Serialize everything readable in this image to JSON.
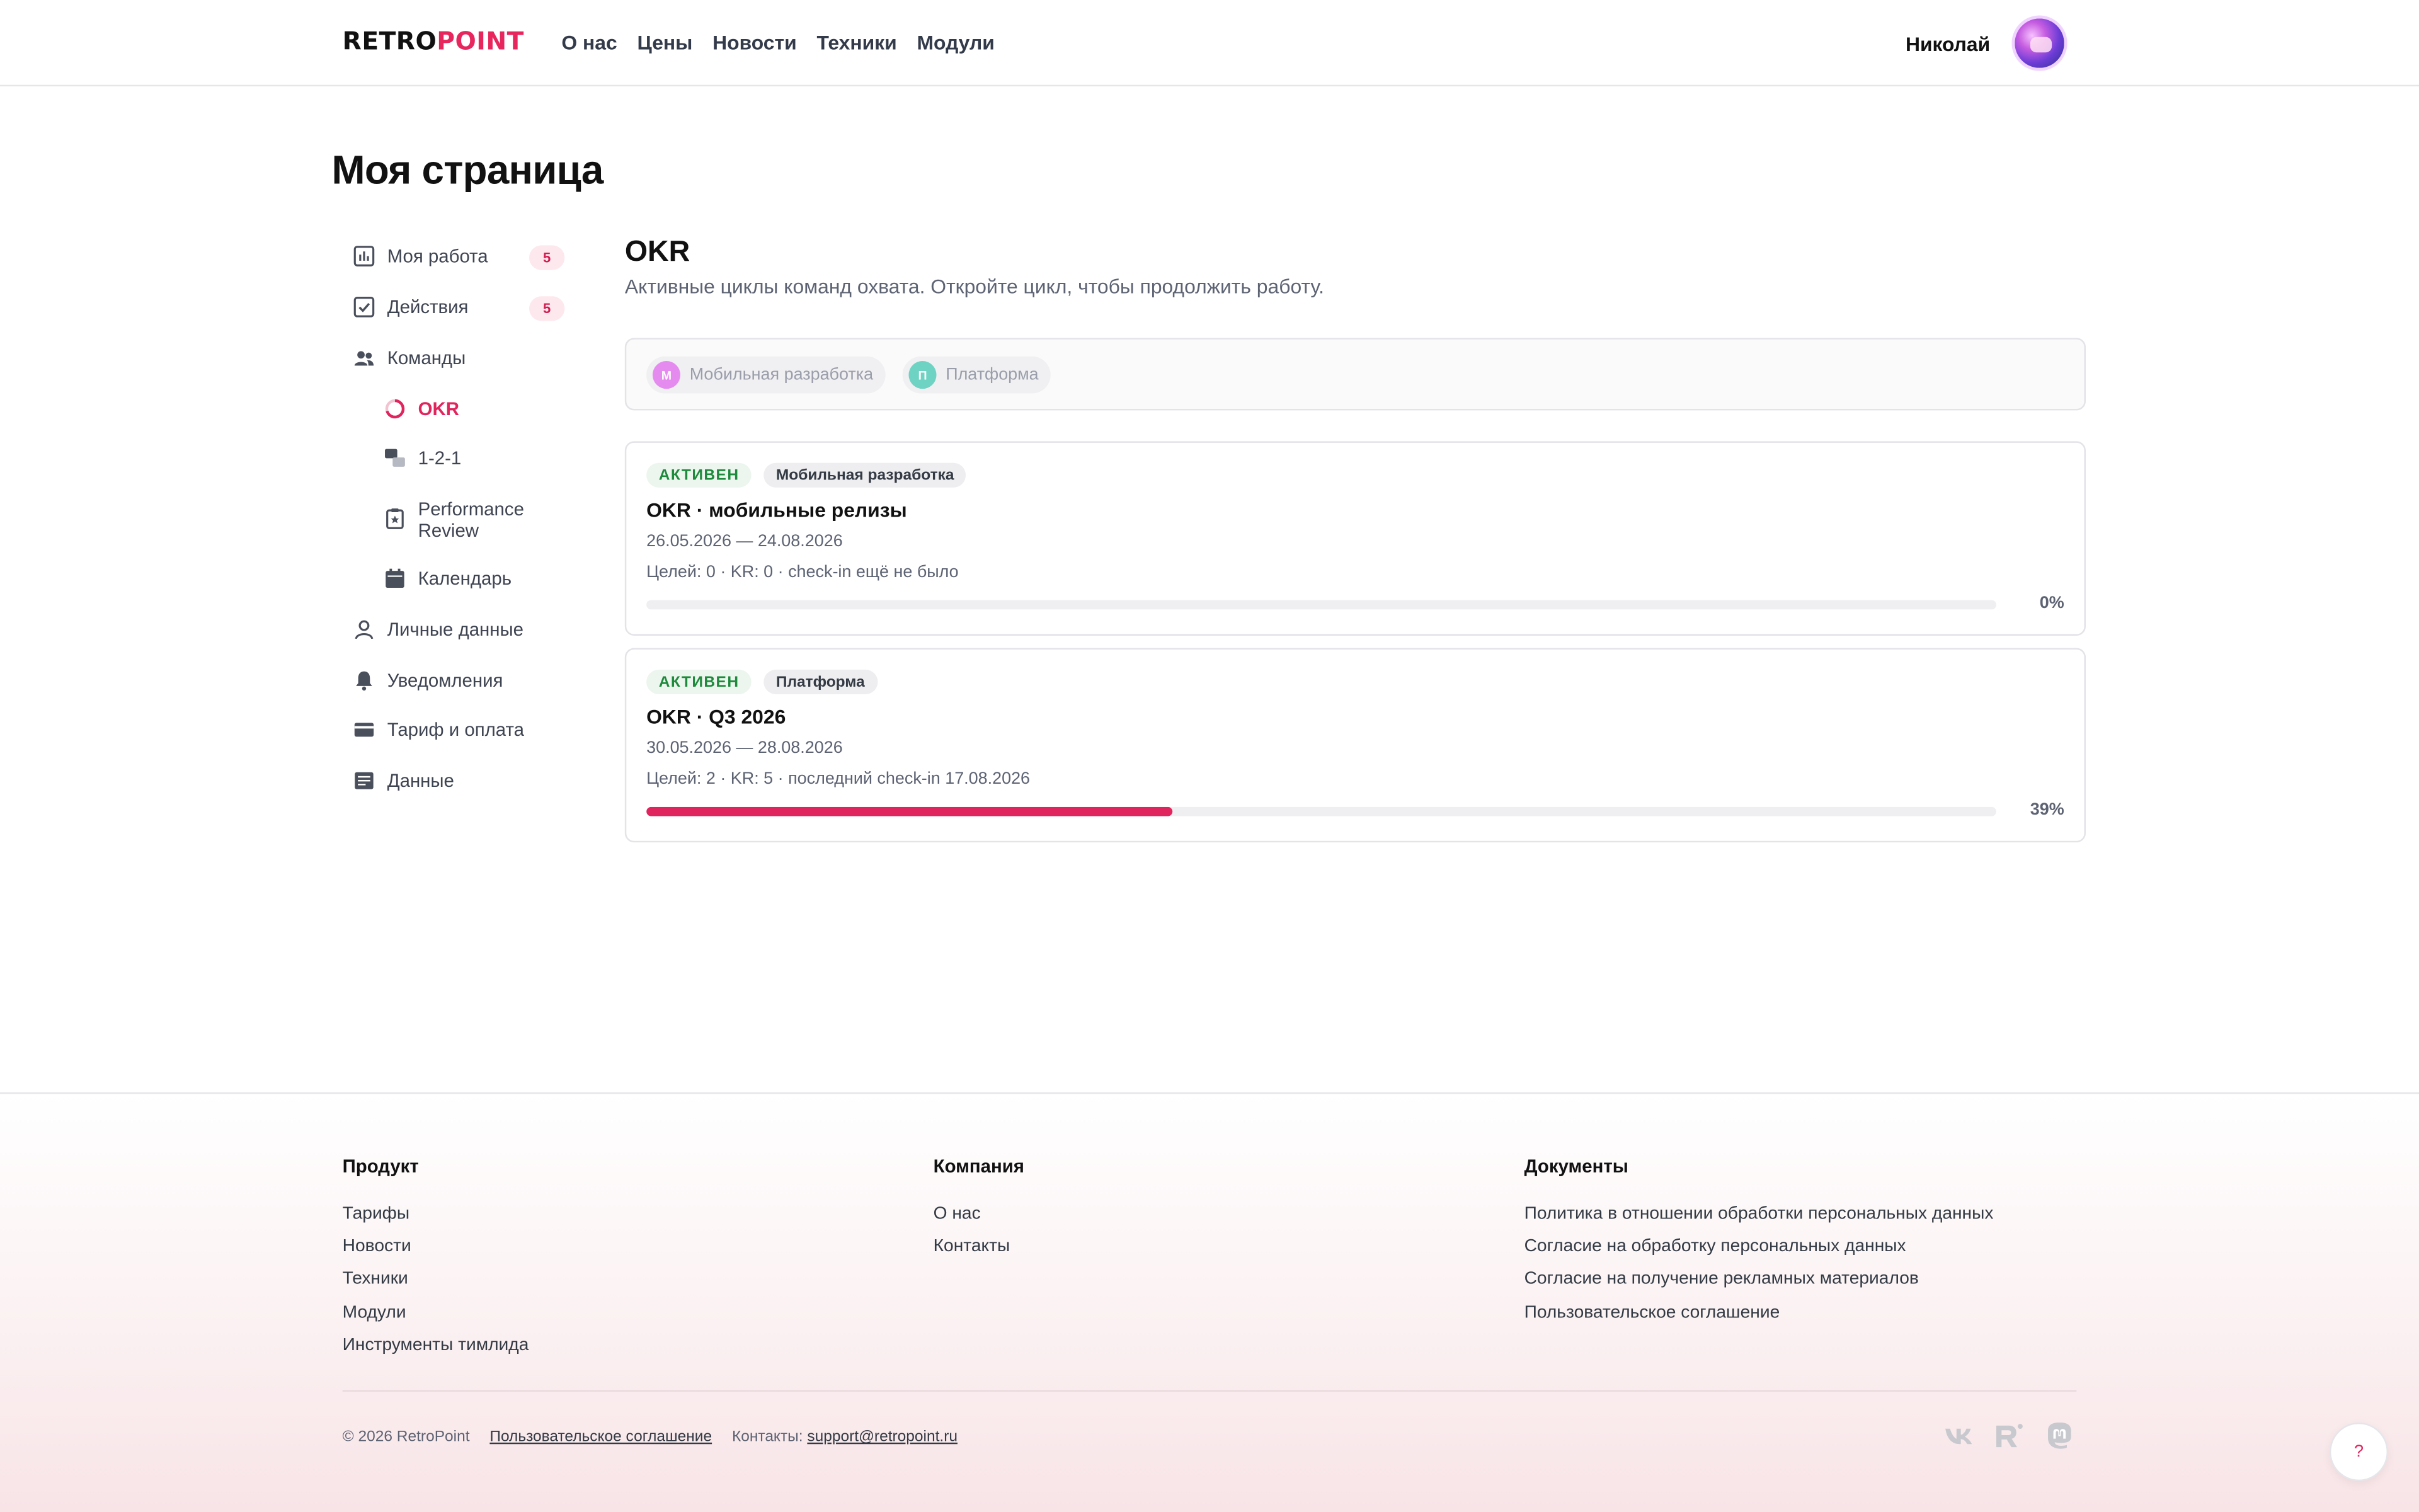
{
  "header": {
    "logo_a": "RETRO",
    "logo_b": "POINT",
    "nav": [
      "О нас",
      "Цены",
      "Новости",
      "Техники",
      "Модули"
    ],
    "user_name": "Николай"
  },
  "page_title": "Моя страница",
  "sidebar": {
    "items": [
      {
        "label": "Моя работа",
        "icon": "chart-icon",
        "badge": "5"
      },
      {
        "label": "Действия",
        "icon": "checkbox-icon",
        "badge": "5"
      },
      {
        "label": "Команды",
        "icon": "team-icon"
      },
      {
        "label": "OKR",
        "icon": "okr-ring-icon",
        "active": true
      },
      {
        "label": "1-2-1",
        "icon": "chat-icon"
      },
      {
        "label": "Performance Review",
        "icon": "clipboard-star-icon"
      },
      {
        "label": "Календарь",
        "icon": "calendar-icon"
      },
      {
        "label": "Личные данные",
        "icon": "person-icon"
      },
      {
        "label": "Уведомления",
        "icon": "bell-icon"
      },
      {
        "label": "Тариф и оплата",
        "icon": "card-icon"
      },
      {
        "label": "Данные",
        "icon": "data-icon"
      }
    ]
  },
  "main": {
    "title": "OKR",
    "subtitle": "Активные циклы команд охвата. Откройте цикл, чтобы продолжить работу.",
    "filters": [
      {
        "initial": "М",
        "label": "Мобильная разработка",
        "color": "#e58bf0"
      },
      {
        "initial": "П",
        "label": "Платформа",
        "color": "#6fd3c4"
      }
    ],
    "cards": [
      {
        "status": "АКТИВЕН",
        "team": "Мобильная разработка",
        "title": "OKR · мобильные релизы",
        "dates": "26.05.2026 — 24.08.2026",
        "meta": "Целей: 0 · KR: 0 · check-in ещё не было",
        "progress": 0,
        "progress_label": "0%"
      },
      {
        "status": "АКТИВЕН",
        "team": "Платформа",
        "title": "OKR · Q3 2026",
        "dates": "30.05.2026 — 28.08.2026",
        "meta": "Целей: 2 · KR: 5 · последний check-in 17.08.2026",
        "progress": 39,
        "progress_label": "39%"
      }
    ]
  },
  "footer": {
    "product": {
      "heading": "Продукт",
      "links": [
        "Тарифы",
        "Новости",
        "Техники",
        "Модули",
        "Инструменты тимлида"
      ]
    },
    "company": {
      "heading": "Компания",
      "links": [
        "О нас",
        "Контакты"
      ]
    },
    "docs": {
      "heading": "Документы",
      "links": [
        "Политика в отношении обработки персональных данных",
        "Согласие на обработку персональных данных",
        "Согласие на получение рекламных материалов",
        "Пользовательское соглашение"
      ]
    },
    "copyright": "© 2026 RetroPoint",
    "agreement": "Пользовательское соглашение",
    "contacts_label": "Контакты:",
    "email": "support@retropoint.ru",
    "social": [
      "vk-icon",
      "retropoint-icon",
      "mastodon-icon"
    ]
  },
  "help_label": "?",
  "accent": "#e0245e"
}
